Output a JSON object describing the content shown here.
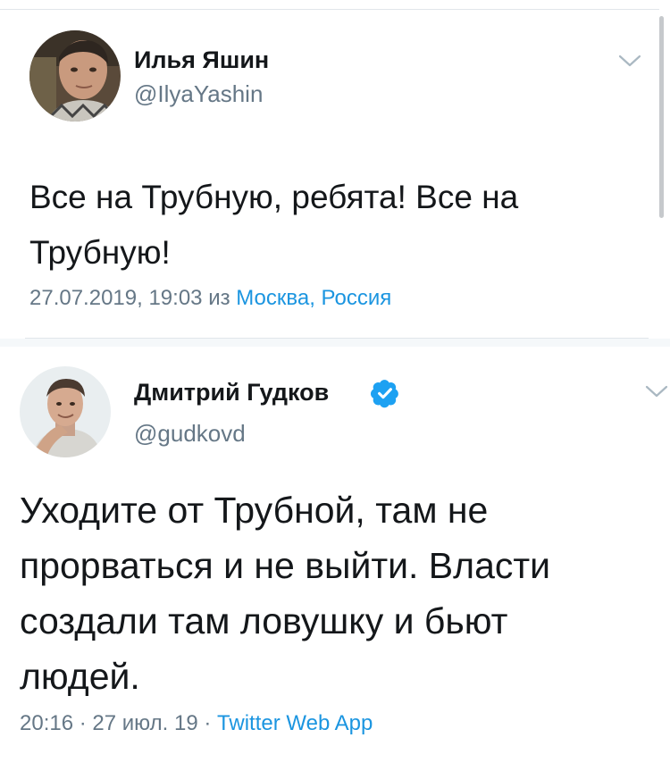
{
  "tweets": [
    {
      "author_name": "Илья Яшин",
      "handle": "@IlyaYashin",
      "verified": false,
      "text_lines": [
        "Все на Трубную, ребята! Все на",
        "Трубную!"
      ],
      "timestamp": "27.07.2019, 19:03",
      "location_prefix": "из",
      "location": "Москва, Россия",
      "menu_icon": "chevron-down-icon"
    },
    {
      "author_name": "Дмитрий Гудков",
      "handle": "@gudkovd",
      "verified": true,
      "text_lines": [
        "Уходите от Трубной, там не",
        "прорваться и не выйти. Власти",
        "создали там ловушку и бьют",
        "людей."
      ],
      "time": "20:16",
      "separator": "·",
      "date": "27 июл. 19",
      "source": "Twitter Web App",
      "menu_icon": "chevron-down-icon"
    }
  ],
  "colors": {
    "primary_text": "#14171a",
    "secondary_text": "#657786",
    "link": "#1b95e0",
    "divider": "#e1e6ea"
  }
}
